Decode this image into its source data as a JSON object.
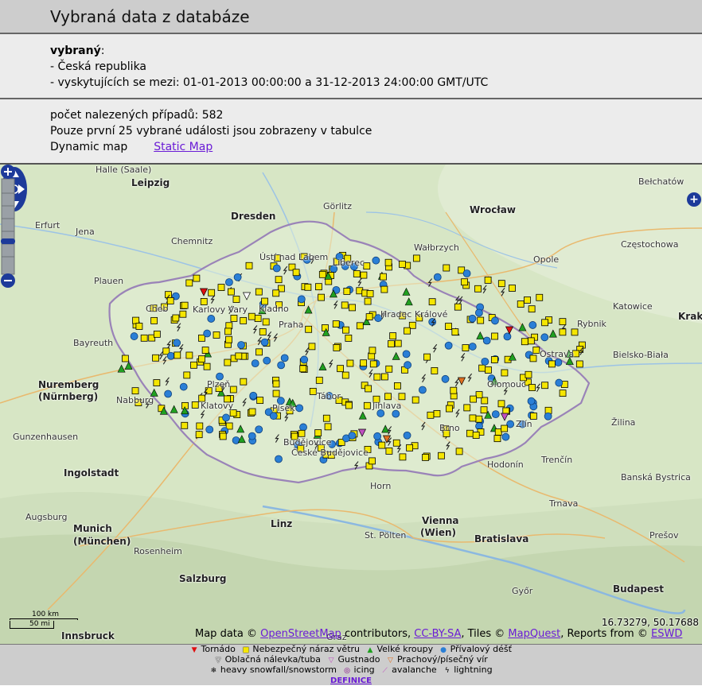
{
  "header": {
    "title": "Vybraná data z databáze"
  },
  "selection": {
    "label": "vybraný",
    "colon": ":",
    "region": "- Česká republika",
    "period": "- vyskytujících se mezi: 01-01-2013 00:00:00 a 31-12-2013 24:00:00 GMT/UTC"
  },
  "results": {
    "count": "počet nalezených případů: 582",
    "note": "Pouze první 25 vybrané události jsou zobrazeny v tabulce",
    "dynamic_map": "Dynamic map",
    "static_map": "Static Map"
  },
  "map": {
    "cities": [
      "Halle (Saale)",
      "Leipzig",
      "Dresden",
      "Chemnitz",
      "Erfurt",
      "Jena",
      "Plauen",
      "Bayreuth",
      "Nuremberg",
      "(Nürnberg)",
      "Nabburg",
      "Ingolstadt",
      "Munich",
      "(München)",
      "Augsburg",
      "Gunzenhausen",
      "Rosenheim",
      "Salzburg",
      "Innsbruck",
      "Wrocław",
      "Wałbrzych",
      "Opole",
      "Częstochowa",
      "Katowice",
      "Rybnik",
      "Bielsko-Biała",
      "Krak",
      "Ostrava",
      "Žilina",
      "Trenčín",
      "Banská Bystrica",
      "Bratislava",
      "Vienna",
      "(Wien)",
      "Linz",
      "St. Pölten",
      "Graz",
      "Győr",
      "Budapest",
      "Horn",
      "Hodonín",
      "Zlín",
      "Olomouc",
      "Brno",
      "Jihlava",
      "Praha",
      "Kladno",
      "Plzeň",
      "Klatovy",
      "Písek",
      "Tábor",
      "Budějovice",
      "České Budějovice",
      "Hradec Králové",
      "Liberec",
      "Ústí nad Labem",
      "Karlovy Vary",
      "Cheb",
      "Görlitz",
      "Bełchatów",
      "Prešov",
      "Trnava"
    ],
    "coords": "16.73279, 50.17688",
    "scale_km": "100 km",
    "scale_mi": "50 mi",
    "attribution_prefix": "Map data ©",
    "attribution_osm": "OpenStreetMap",
    "attribution_mid": "contributors,",
    "attribution_license": "CC-BY-SA",
    "attribution_tiles": ", Tiles ©",
    "attribution_mapquest": "MapQuest",
    "attribution_reports": ", Reports from ©",
    "attribution_eswd": "ESWD",
    "expand_label": "+"
  },
  "legend": {
    "row1": [
      {
        "icon": "tornado-icon",
        "symbol": "▼",
        "color": "#e01010",
        "label": "Tornádo"
      },
      {
        "icon": "wind-gust-icon",
        "symbol": "■",
        "color": "#f5e600",
        "label": "Nebezpečný náraz větru"
      },
      {
        "icon": "hail-icon",
        "symbol": "▲",
        "color": "#20a020",
        "label": "Velké kroupy"
      },
      {
        "icon": "heavy-rain-icon",
        "symbol": "●",
        "color": "#2a7fd6",
        "label": "Přívalový déšť"
      }
    ],
    "row2": [
      {
        "icon": "funnel-cloud-icon",
        "symbol": "▽",
        "color": "#ffffff",
        "label": "Oblačná nálevka/tuba"
      },
      {
        "icon": "gustnado-icon",
        "symbol": "▽",
        "color": "#c050c0",
        "label": "Gustnado"
      },
      {
        "icon": "dust-devil-icon",
        "symbol": "▽",
        "color": "#e07020",
        "label": "Prachový/písečný vír"
      }
    ],
    "row3": [
      {
        "icon": "snowfall-icon",
        "symbol": "❄",
        "color": "#000000",
        "label": "heavy snowfall/snowstorm"
      },
      {
        "icon": "icing-icon",
        "symbol": "◎",
        "color": "#800080",
        "label": "icing"
      },
      {
        "icon": "avalanche-icon",
        "symbol": "⟋",
        "color": "#c050c0",
        "label": "avalanche"
      },
      {
        "icon": "lightning-icon",
        "symbol": "ϟ",
        "color": "#000000",
        "label": "lightning"
      }
    ],
    "definice": "DEFINICE"
  }
}
